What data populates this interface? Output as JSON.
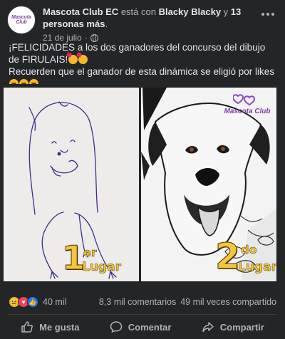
{
  "post": {
    "author": "Mascota Club EC",
    "with_text": "está con",
    "tagged": "Blacky Blacky",
    "and_text": "y",
    "others": "13 personas más",
    "period": ".",
    "date": "21 de julio",
    "dot": "·",
    "avatar_text": "Mascota Club",
    "text_line1": "¡FELICIDADES a los dos ganadores del concurso del dibujo de FIRULAIS!",
    "text_line2": "Recuerden que el ganador de esta dinámica se eligió por likes"
  },
  "photos": {
    "left": {
      "num": "1",
      "sup": "er",
      "place": "Lugar"
    },
    "right": {
      "num": "2",
      "sup": "do",
      "place": "Lugar",
      "logo": "Mascota Club"
    }
  },
  "reactions": {
    "icons": [
      "haha-icon",
      "love-icon",
      "like-icon"
    ],
    "count": "40 mil",
    "comments": "8,3 mil comentarios",
    "shares": "49 mil veces compartido"
  },
  "actions": {
    "like": "Me gusta",
    "comment": "Comentar",
    "share": "Compartir"
  },
  "colors": {
    "accent": "#f4c63d",
    "brand": "#7b3fa0",
    "bg": "#242526",
    "text": "#e4e6eb"
  }
}
